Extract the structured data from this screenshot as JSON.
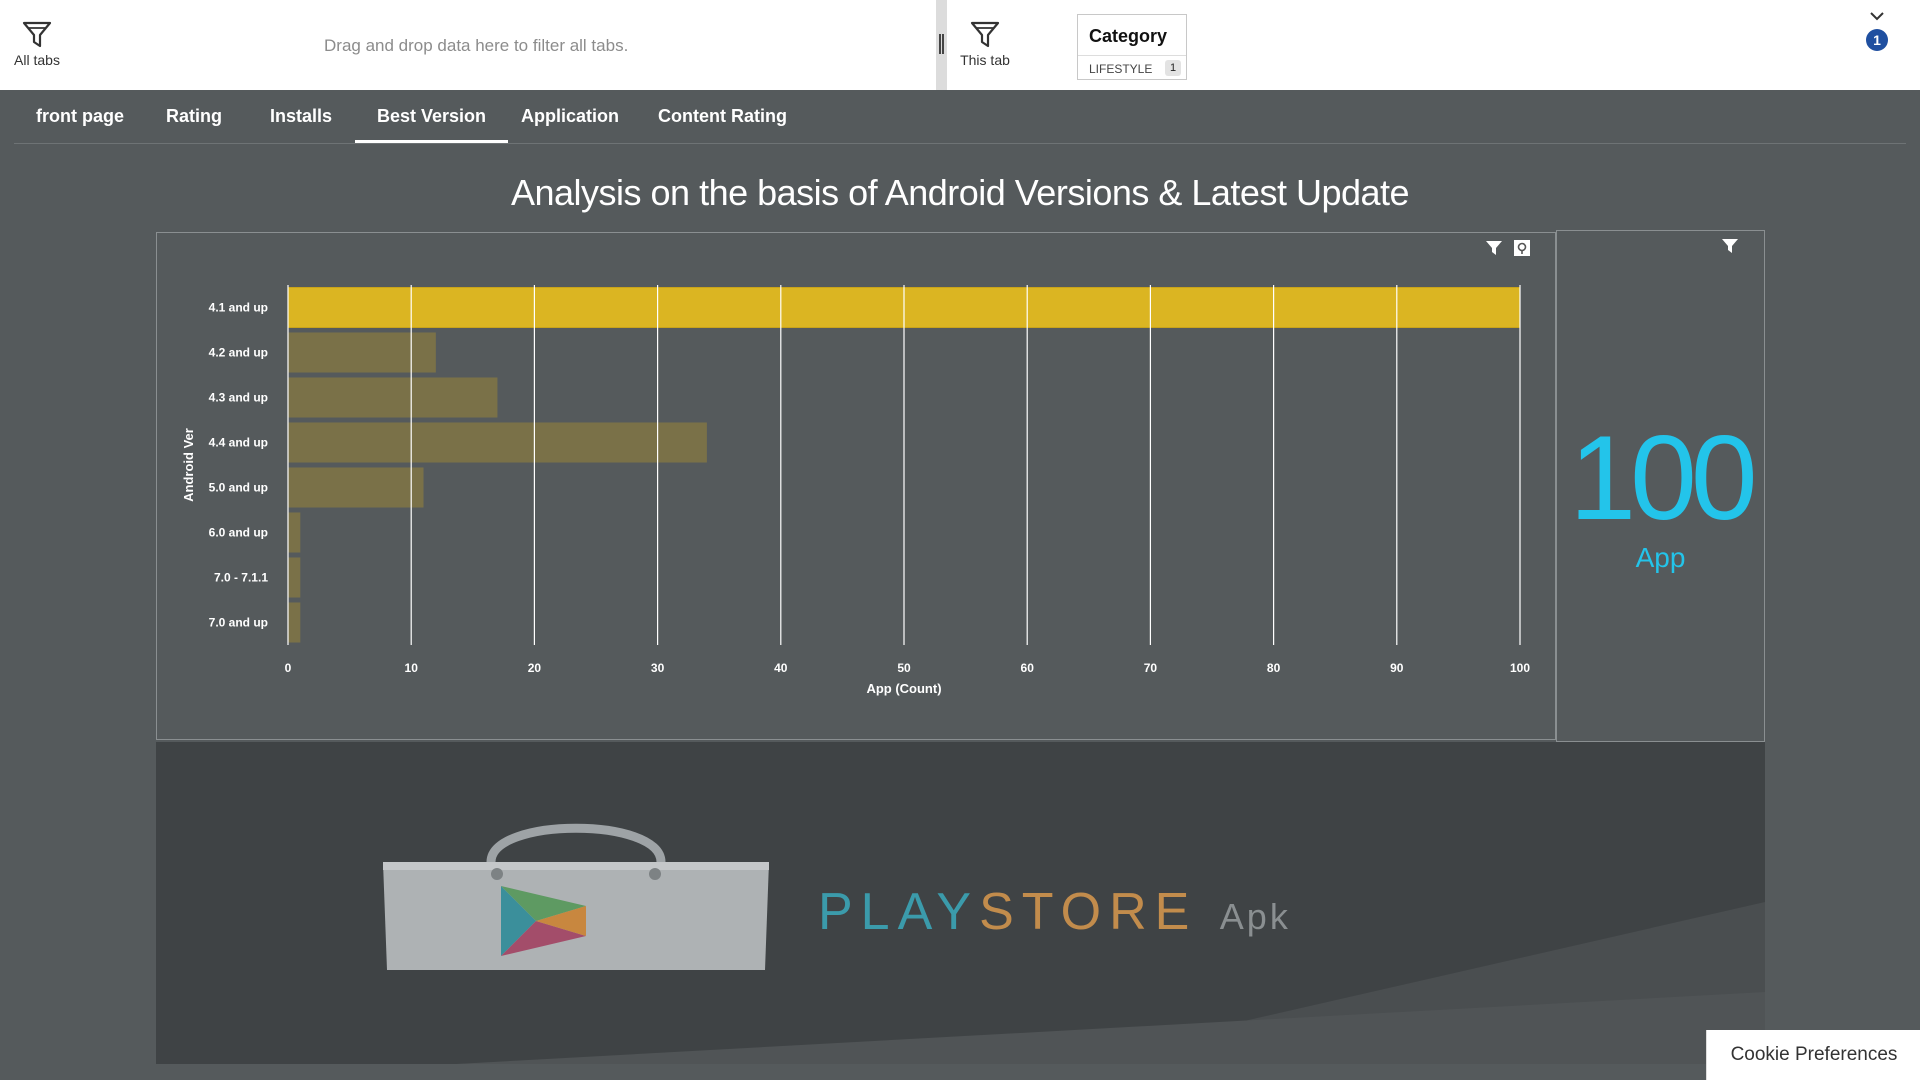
{
  "filter_bar": {
    "all_tabs_label": "All tabs",
    "drop_hint": "Drag and drop data here to filter all tabs.",
    "this_tab_label": "This tab",
    "category": {
      "title": "Category",
      "value": "LIFESTYLE",
      "count": "1"
    },
    "active_filters_badge": "1"
  },
  "tabs": [
    {
      "label": "front page",
      "active": false
    },
    {
      "label": "Rating",
      "active": false
    },
    {
      "label": "Installs",
      "active": false
    },
    {
      "label": "Best Version",
      "active": true
    },
    {
      "label": "Application",
      "active": false
    },
    {
      "label": "Content Rating",
      "active": false
    }
  ],
  "page_title": "Analysis on the basis of Android Versions & Latest Update",
  "chart_data": {
    "type": "bar",
    "orientation": "horizontal",
    "categories": [
      "4.1 and up",
      "4.2 and up",
      "4.3 and up",
      "4.4 and up",
      "5.0 and up",
      "6.0 and up",
      "7.0 - 7.1.1",
      "7.0 and up"
    ],
    "values": [
      100,
      12,
      17,
      34,
      11,
      1,
      1,
      1
    ],
    "highlighted": "4.1 and up",
    "xlabel": "App (Count)",
    "ylabel": "Android Ver",
    "xlim": [
      0,
      100
    ],
    "xticks": [
      0,
      10,
      20,
      30,
      40,
      50,
      60,
      70,
      80,
      90,
      100
    ],
    "grid": true,
    "colors": {
      "highlight": "#dbb522",
      "bar": "#7a7148",
      "grid": "#ffffff"
    }
  },
  "kpi": {
    "value": "100",
    "label": "App"
  },
  "banner": {
    "logo_play": "PLAY",
    "logo_store": "STORE",
    "logo_apk": "Apk"
  },
  "cookie_button": "Cookie Preferences",
  "colors": {
    "background": "#555a5c",
    "kpi": "#23c4ea",
    "badge": "#1f4fa0"
  }
}
